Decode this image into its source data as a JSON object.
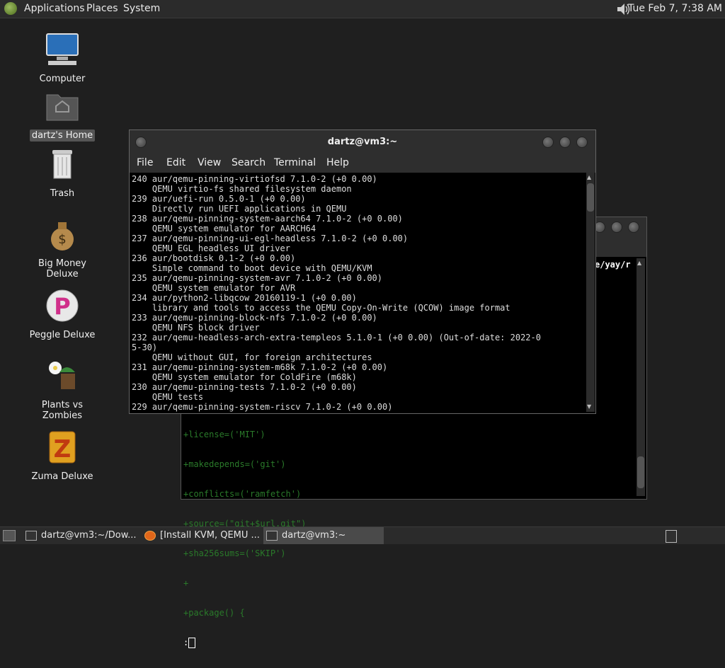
{
  "top_panel": {
    "menus": [
      "Applications",
      "Places",
      "System"
    ],
    "clock": "Tue Feb  7, 7:38 AM"
  },
  "desktop_icons": [
    {
      "label": "Computer",
      "icon": "computer-icon"
    },
    {
      "label": "dartz's Home",
      "icon": "home-folder-icon"
    },
    {
      "label": "Trash",
      "icon": "trash-icon"
    },
    {
      "label": "Big Money Deluxe",
      "icon": "money-bag-icon"
    },
    {
      "label": "Peggle Deluxe",
      "icon": "peggle-icon"
    },
    {
      "label": "Plants vs Zombies",
      "icon": "plants-icon"
    },
    {
      "label": "Zuma Deluxe",
      "icon": "zuma-icon"
    }
  ],
  "front_terminal": {
    "title": "dartz@vm3:~",
    "menu": [
      "File",
      "Edit",
      "View",
      "Search",
      "Terminal",
      "Help"
    ],
    "lines": [
      "240 aur/qemu-pinning-virtiofsd 7.1.0-2 (+0 0.00)",
      "    QEMU virtio-fs shared filesystem daemon",
      "239 aur/uefi-run 0.5.0-1 (+0 0.00)",
      "    Directly run UEFI applications in QEMU",
      "238 aur/qemu-pinning-system-aarch64 7.1.0-2 (+0 0.00)",
      "    QEMU system emulator for AARCH64",
      "237 aur/qemu-pinning-ui-egl-headless 7.1.0-2 (+0 0.00)",
      "    QEMU EGL headless UI driver",
      "236 aur/bootdisk 0.1-2 (+0 0.00)",
      "    Simple command to boot device with QEMU/KVM",
      "235 aur/qemu-pinning-system-avr 7.1.0-2 (+0 0.00)",
      "    QEMU system emulator for AVR",
      "234 aur/python2-libqcow 20160119-1 (+0 0.00)",
      "    library and tools to access the QEMU Copy-On-Write (QCOW) image format",
      "233 aur/qemu-pinning-block-nfs 7.1.0-2 (+0 0.00)",
      "    QEMU NFS block driver",
      "232 aur/qemu-headless-arch-extra-templeos 5.1.0-1 (+0 0.00) (Out-of-date: 2022-0",
      "5-30)",
      "    QEMU without GUI, for foreign architectures",
      "231 aur/qemu-pinning-system-m68k 7.1.0-2 (+0 0.00)",
      "    QEMU system emulator for ColdFire (m68k)",
      "230 aur/qemu-pinning-tests 7.1.0-2 (+0 0.00)",
      "    QEMU tests",
      "229 aur/qemu-pinning-system-riscv 7.1.0-2 (+0 0.00)"
    ]
  },
  "back_terminal": {
    "path_fragment": "e/yay/r",
    "lines": [
      "+license=('MIT')",
      "+makedepends=('git')",
      "+conflicts=('ramfetch')",
      "+source=(\"git+$url.git\")",
      "+sha256sums=('SKIP')",
      "+",
      "+package() {"
    ],
    "prompt": ":"
  },
  "taskbar": {
    "tasks": [
      {
        "label": "dartz@vm3:~/Dow...",
        "active": false
      },
      {
        "label": "[Install KVM, QEMU ...",
        "active": false
      },
      {
        "label": "dartz@vm3:~",
        "active": true
      }
    ]
  }
}
